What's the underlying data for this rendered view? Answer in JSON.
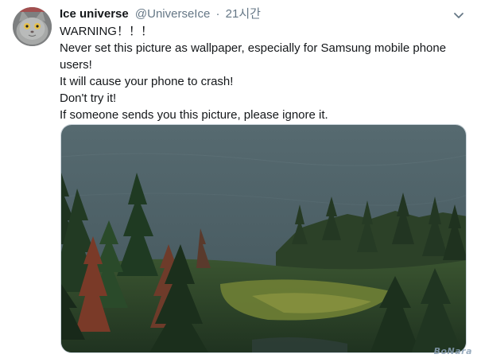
{
  "author": {
    "name": "Ice universe",
    "handle": "@UniverseIce",
    "separator": "·",
    "time": "21시간"
  },
  "tweet": {
    "lines": [
      "WARNING！！！",
      "Never set this picture as wallpaper, especially for Samsung mobile phone users!",
      "It will cause your phone to crash!",
      "Don't try it!",
      "If someone sends you this picture, please ignore it."
    ]
  },
  "icons": {
    "avatar": "cat-avatar",
    "menu": "chevron-down-icon"
  },
  "colors": {
    "text": "#14171a",
    "secondary": "#657786",
    "lake": "#4d6066",
    "forest": "#2f4a2a",
    "meadow": "#7a8a3c"
  },
  "watermark": "BoNara"
}
